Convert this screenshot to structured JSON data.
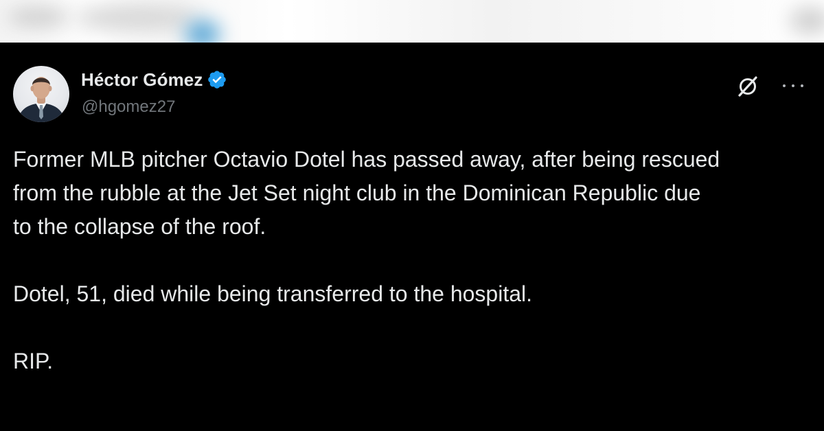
{
  "author": {
    "display_name": "Héctor Gómez",
    "handle": "@hgomez27",
    "verified": true,
    "avatar_icon": "person-avatar"
  },
  "actions": {
    "grok_icon": "grok-slash-icon",
    "more_icon": "more-dots-icon"
  },
  "post": {
    "paragraph_1": "Former MLB pitcher Octavio Dotel has passed away, after being rescued\nfrom the rubble at the Jet Set night club in the Dominican Republic due\nto the collapse of the roof.",
    "paragraph_2": "Dotel, 51, died while being transferred to the hospital.",
    "paragraph_3": "RIP."
  },
  "colors": {
    "background": "#000000",
    "text_primary": "#e7e9ea",
    "text_secondary": "#71767b",
    "verified_blue": "#1d9bf0"
  }
}
